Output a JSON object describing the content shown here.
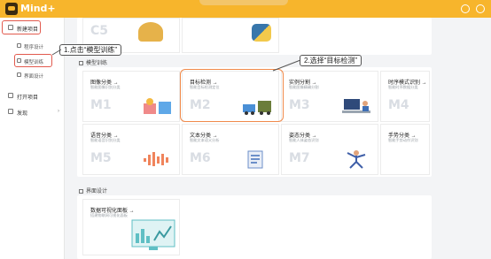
{
  "app": {
    "title": "Mind+"
  },
  "sidebar": {
    "new_project": "新建项目",
    "sub_items": [
      "程序设计",
      "模型训练",
      "界面设计"
    ],
    "open_project": "打开项目",
    "discover": "发现"
  },
  "main": {
    "top_cards": [
      {
        "code": "C5"
      }
    ],
    "model_section_title": "模型训练",
    "model_cards": [
      {
        "title": "图像分类",
        "subtitle": "智能图像识别分类",
        "code": "M1"
      },
      {
        "title": "目标检测",
        "subtitle": "智能目标检测定位",
        "code": "M2"
      },
      {
        "title": "实例分割",
        "subtitle": "智能图像精确分割",
        "code": "M3"
      },
      {
        "title": "时序模式识别",
        "subtitle": "智能时序数据分类",
        "code": "M4"
      },
      {
        "title": "语音分类",
        "subtitle": "智能语音识别分类",
        "code": "M5"
      },
      {
        "title": "文本分类",
        "subtitle": "智能文本语义分析",
        "code": "M6"
      },
      {
        "title": "姿态分类",
        "subtitle": "智能人体姿态识别",
        "code": "M7"
      },
      {
        "title": "手势分类",
        "subtitle": "智能手势动作识别",
        "code": ""
      }
    ],
    "ui_section_title": "界面设计",
    "ui_cards": [
      {
        "title": "数据可视化面板",
        "subtitle": "搭建物联网可视化面板"
      }
    ]
  },
  "annotations": {
    "step1": "1.点击“模型训练”",
    "step2": "2.选择“目标检测”"
  }
}
